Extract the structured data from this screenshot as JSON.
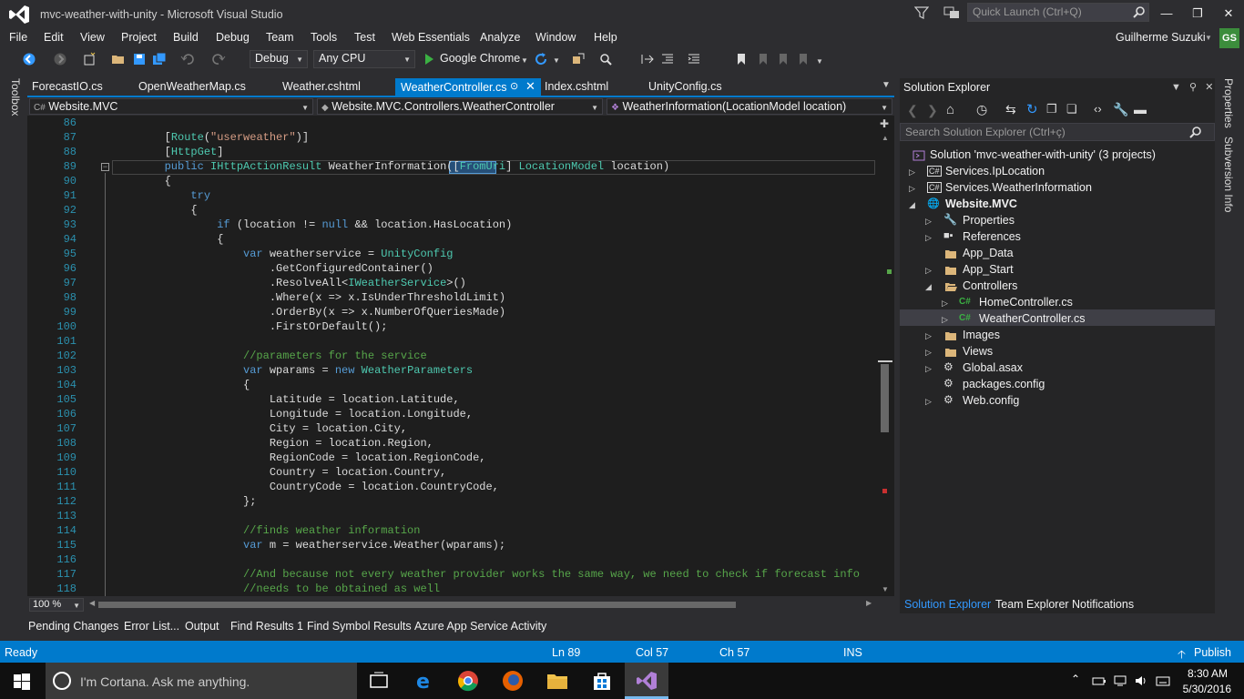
{
  "window": {
    "title": "mvc-weather-with-unity - Microsoft Visual Studio",
    "quick_launch_placeholder": "Quick Launch (Ctrl+Q)",
    "user": "Guilherme Suzuki",
    "avatar_initials": "GS"
  },
  "menu": [
    "File",
    "Edit",
    "View",
    "Project",
    "Build",
    "Debug",
    "Team",
    "Tools",
    "Test",
    "Web Essentials",
    "Analyze",
    "Window",
    "Help"
  ],
  "toolbar": {
    "configuration": "Debug",
    "platform": "Any CPU",
    "browser": "Google Chrome"
  },
  "left_tab": "Toolbox",
  "tabs": [
    "ForecastIO.cs",
    "OpenWeatherMap.cs",
    "Weather.cshtml",
    "WeatherController.cs",
    "Index.cshtml",
    "UnityConfig.cs"
  ],
  "active_tab": "WeatherController.cs",
  "nav": {
    "project": "Website.MVC",
    "class": "Website.MVC.Controllers.WeatherController",
    "member": "WeatherInformation(LocationModel location)"
  },
  "code_lines": [
    {
      "n": "86",
      "t": ""
    },
    {
      "n": "87",
      "t": "        [Route(\"userweather\")]"
    },
    {
      "n": "88",
      "t": "        [HttpGet]"
    },
    {
      "n": "89",
      "t": "        public IHttpActionResult WeatherInformation([FromUri] LocationModel location)"
    },
    {
      "n": "90",
      "t": "        {"
    },
    {
      "n": "91",
      "t": "            try"
    },
    {
      "n": "92",
      "t": "            {"
    },
    {
      "n": "93",
      "t": "                if (location != null && location.HasLocation)"
    },
    {
      "n": "94",
      "t": "                {"
    },
    {
      "n": "95",
      "t": "                    var weatherservice = UnityConfig"
    },
    {
      "n": "96",
      "t": "                        .GetConfiguredContainer()"
    },
    {
      "n": "97",
      "t": "                        .ResolveAll<IWeatherService>()"
    },
    {
      "n": "98",
      "t": "                        .Where(x => x.IsUnderThresholdLimit)"
    },
    {
      "n": "99",
      "t": "                        .OrderBy(x => x.NumberOfQueriesMade)"
    },
    {
      "n": "100",
      "t": "                        .FirstOrDefault();"
    },
    {
      "n": "101",
      "t": ""
    },
    {
      "n": "102",
      "t": "                    //parameters for the service"
    },
    {
      "n": "103",
      "t": "                    var wparams = new WeatherParameters"
    },
    {
      "n": "104",
      "t": "                    {"
    },
    {
      "n": "105",
      "t": "                        Latitude = location.Latitude,"
    },
    {
      "n": "106",
      "t": "                        Longitude = location.Longitude,"
    },
    {
      "n": "107",
      "t": "                        City = location.City,"
    },
    {
      "n": "108",
      "t": "                        Region = location.Region,"
    },
    {
      "n": "109",
      "t": "                        RegionCode = location.RegionCode,"
    },
    {
      "n": "110",
      "t": "                        Country = location.Country,"
    },
    {
      "n": "111",
      "t": "                        CountryCode = location.CountryCode,"
    },
    {
      "n": "112",
      "t": "                    };"
    },
    {
      "n": "113",
      "t": ""
    },
    {
      "n": "114",
      "t": "                    //finds weather information"
    },
    {
      "n": "115",
      "t": "                    var m = weatherservice.Weather(wparams);"
    },
    {
      "n": "116",
      "t": ""
    },
    {
      "n": "117",
      "t": "                    //And because not every weather provider works the same way, we need to check if forecast info"
    },
    {
      "n": "118",
      "t": "                    //needs to be obtained as well"
    }
  ],
  "zoom": "100 %",
  "solution_explorer": {
    "title": "Solution Explorer",
    "search_placeholder": "Search Solution Explorer (Ctrl+ç)",
    "items": [
      {
        "label": "Solution 'mvc-weather-with-unity' (3 projects)",
        "icon": "solution-icon"
      },
      {
        "label": "Services.IpLocation",
        "icon": "csharp-project-icon"
      },
      {
        "label": "Services.WeatherInformation",
        "icon": "csharp-project-icon"
      },
      {
        "label": "Website.MVC",
        "icon": "web-project-icon"
      },
      {
        "label": "Properties",
        "icon": "wrench-icon"
      },
      {
        "label": "References",
        "icon": "references-icon"
      },
      {
        "label": "App_Data",
        "icon": "folder-icon"
      },
      {
        "label": "App_Start",
        "icon": "folder-icon"
      },
      {
        "label": "Controllers",
        "icon": "folder-icon"
      },
      {
        "label": "HomeController.cs",
        "icon": "csharp-file-icon"
      },
      {
        "label": "WeatherController.cs",
        "icon": "csharp-file-icon"
      },
      {
        "label": "Images",
        "icon": "folder-icon"
      },
      {
        "label": "Views",
        "icon": "folder-icon"
      },
      {
        "label": "Global.asax",
        "icon": "file-icon"
      },
      {
        "label": "packages.config",
        "icon": "config-icon"
      },
      {
        "label": "Web.config",
        "icon": "config-icon"
      }
    ],
    "tabs": [
      "Solution Explorer",
      "Team Explorer",
      "Notifications"
    ]
  },
  "right_side_tabs": [
    "Properties",
    "Subversion Info"
  ],
  "bottom_tabs": [
    "Pending Changes",
    "Error List...",
    "Output",
    "Find Results 1",
    "Find Symbol Results",
    "Azure App Service Activity"
  ],
  "status": {
    "state": "Ready",
    "ln": "Ln 89",
    "col": "Col 57",
    "ch": "Ch 57",
    "mode": "INS",
    "publish": "Publish"
  },
  "taskbar": {
    "cortana": "I'm Cortana. Ask me anything.",
    "time": "8:30 AM",
    "date": "5/30/2016"
  },
  "colors": {
    "accent": "#007acc",
    "background": "#2d2d30",
    "editor": "#1e1e1e"
  }
}
